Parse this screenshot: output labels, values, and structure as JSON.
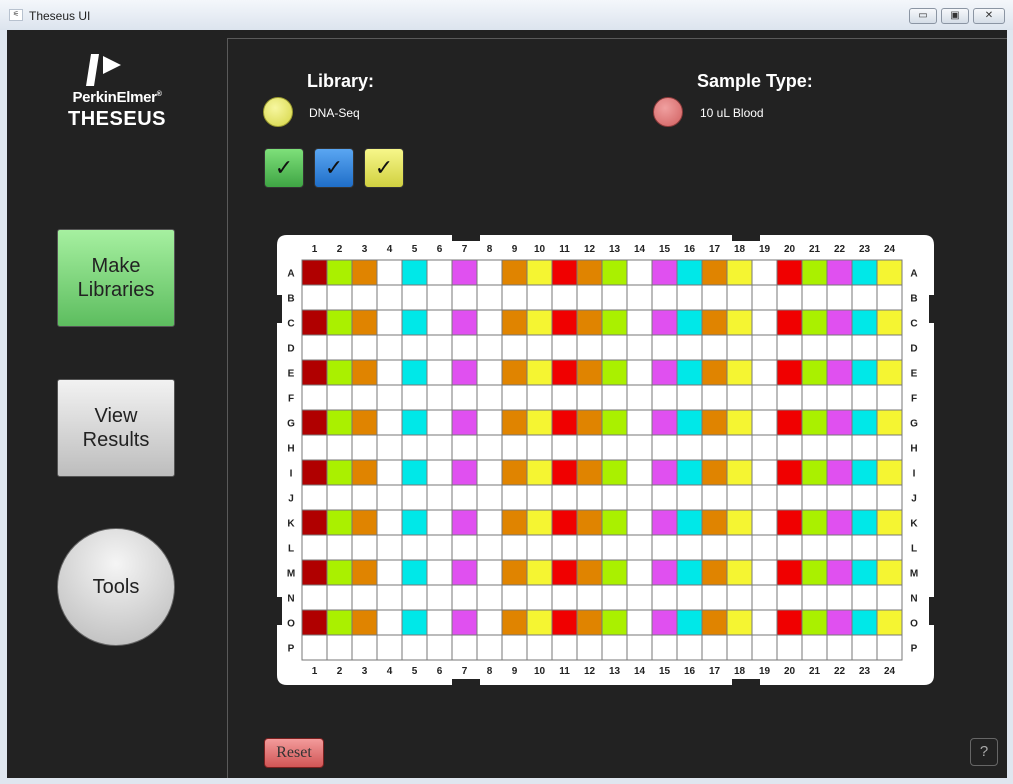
{
  "window": {
    "title": "Theseus UI",
    "controls": {
      "minimize": "▭",
      "maximize": "▣",
      "close": "✕"
    }
  },
  "logo": {
    "brand": "PerkinElmer",
    "trademark": "®",
    "product": "THESEUS"
  },
  "nav": {
    "make": "Make\nLibraries",
    "view": "View\nResults",
    "tools": "Tools"
  },
  "library": {
    "heading": "Library:",
    "value": "DNA-Seq",
    "color": "#e6e65e"
  },
  "sample": {
    "heading": "Sample Type:",
    "value": "10 uL Blood",
    "color": "#e06b6b"
  },
  "checks": [
    "✓",
    "✓",
    "✓"
  ],
  "plate": {
    "columns": [
      "1",
      "2",
      "3",
      "4",
      "5",
      "6",
      "7",
      "8",
      "9",
      "10",
      "11",
      "12",
      "13",
      "14",
      "15",
      "16",
      "17",
      "18",
      "19",
      "20",
      "21",
      "22",
      "23",
      "24"
    ],
    "rows": [
      "A",
      "B",
      "C",
      "D",
      "E",
      "F",
      "G",
      "H",
      "I",
      "J",
      "K",
      "L",
      "M",
      "N",
      "O",
      "P"
    ],
    "filled_rows": [
      "A",
      "C",
      "E",
      "G",
      "I",
      "K",
      "M",
      "O"
    ],
    "filled_pattern": [
      "red-dark",
      "lime",
      "orange",
      "empty",
      "cyan",
      "empty",
      "magenta",
      "empty",
      "orange",
      "yellow",
      "red",
      "orange",
      "lime",
      "empty",
      "magenta",
      "cyan",
      "orange",
      "yellow",
      "empty",
      "red",
      "lime",
      "magenta",
      "cyan",
      "yellow"
    ],
    "colors": {
      "red-dark": "#b00000",
      "lime": "#aaf000",
      "orange": "#e08400",
      "cyan": "#00e8e8",
      "magenta": "#e050f0",
      "yellow": "#f5f532",
      "red": "#f00000",
      "empty": "#ffffff"
    }
  },
  "reset": "Reset",
  "help": "?"
}
